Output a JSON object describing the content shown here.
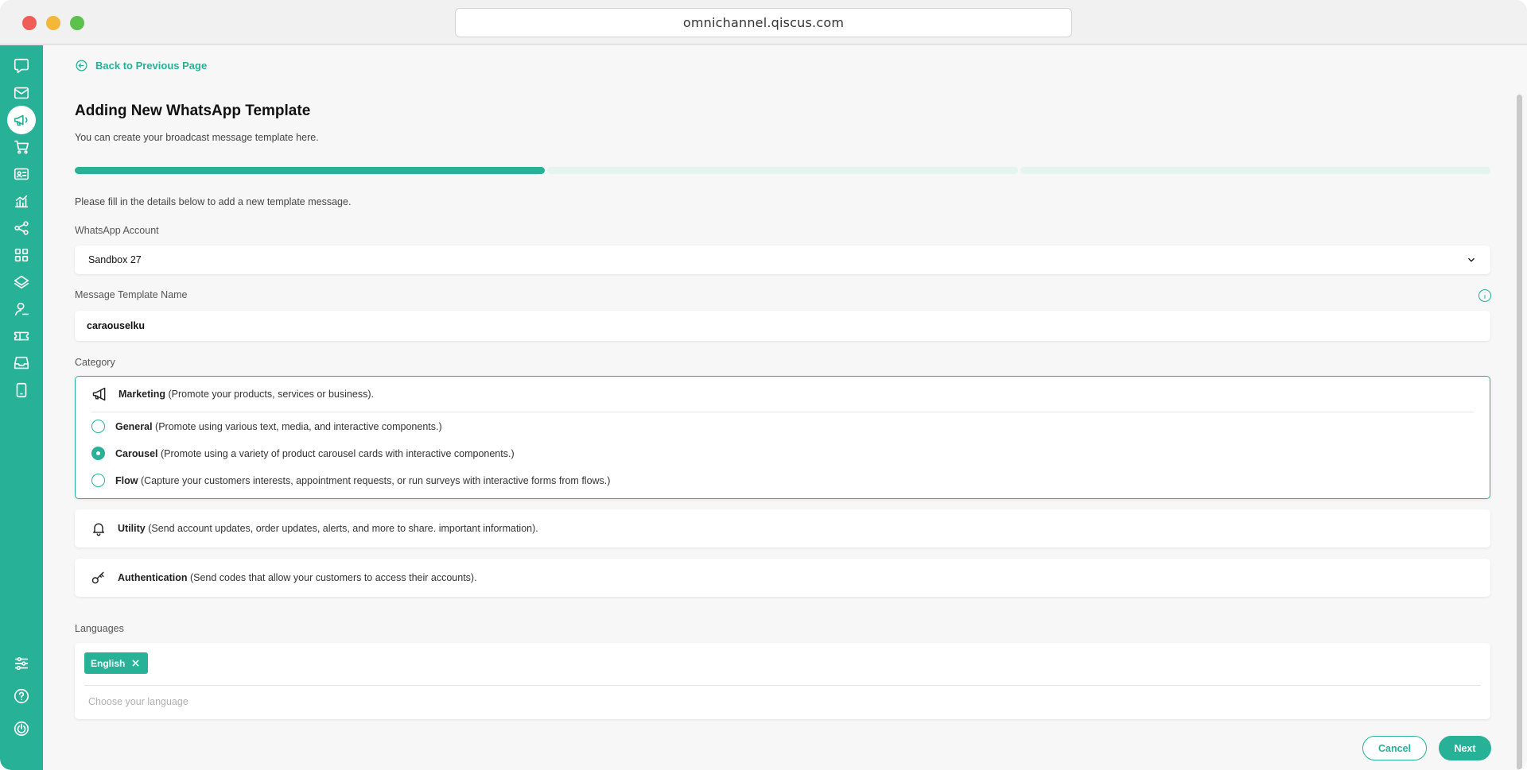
{
  "browser": {
    "url": "omnichannel.qiscus.com"
  },
  "colors": {
    "brand": "#27b197"
  },
  "sidebar": {
    "items": [
      {
        "icon": "chat-bubble-icon"
      },
      {
        "icon": "mail-icon"
      },
      {
        "icon": "megaphone-icon",
        "active": true
      },
      {
        "icon": "cart-icon"
      },
      {
        "icon": "contact-card-icon"
      },
      {
        "icon": "analytics-icon"
      },
      {
        "icon": "share-nodes-icon"
      },
      {
        "icon": "apps-grid-icon"
      },
      {
        "icon": "layers-icon"
      },
      {
        "icon": "user-icon"
      },
      {
        "icon": "ticket-icon"
      },
      {
        "icon": "inbox-icon"
      },
      {
        "icon": "mobile-icon"
      }
    ],
    "bottom": [
      {
        "icon": "sliders-icon"
      },
      {
        "icon": "help-icon"
      },
      {
        "icon": "power-icon"
      }
    ]
  },
  "page": {
    "back_label": "Back to Previous Page",
    "title": "Adding New WhatsApp Template",
    "subtitle": "You can create your broadcast message template here.",
    "progress": {
      "current_step": 1,
      "total_steps": 3
    },
    "instruction": "Please fill in the details below to add a new template message."
  },
  "form": {
    "account_label": "WhatsApp Account",
    "account_value": "Sandbox 27",
    "template_name_label": "Message Template Name",
    "template_name_value": "caraouselku",
    "category_label": "Category",
    "categories": {
      "marketing": {
        "name": "Marketing",
        "desc": " (Promote your products, services or business).",
        "options": [
          {
            "name": "General",
            "desc": " (Promote using various text, media, and interactive components.)",
            "selected": false
          },
          {
            "name": "Carousel",
            "desc": " (Promote using a variety of product carousel cards with interactive components.)",
            "selected": true
          },
          {
            "name": "Flow",
            "desc": " (Capture your customers interests, appointment requests, or run surveys with interactive forms from flows.)",
            "selected": false
          }
        ]
      },
      "utility": {
        "name": "Utility",
        "desc": " (Send account updates, order updates, alerts, and more to share. important information)."
      },
      "authentication": {
        "name": "Authentication",
        "desc": " (Send codes that allow your customers to access their accounts)."
      }
    },
    "languages_label": "Languages",
    "languages_selected": [
      "English"
    ],
    "languages_placeholder": "Choose your language"
  },
  "actions": {
    "cancel_label": "Cancel",
    "next_label": "Next"
  }
}
